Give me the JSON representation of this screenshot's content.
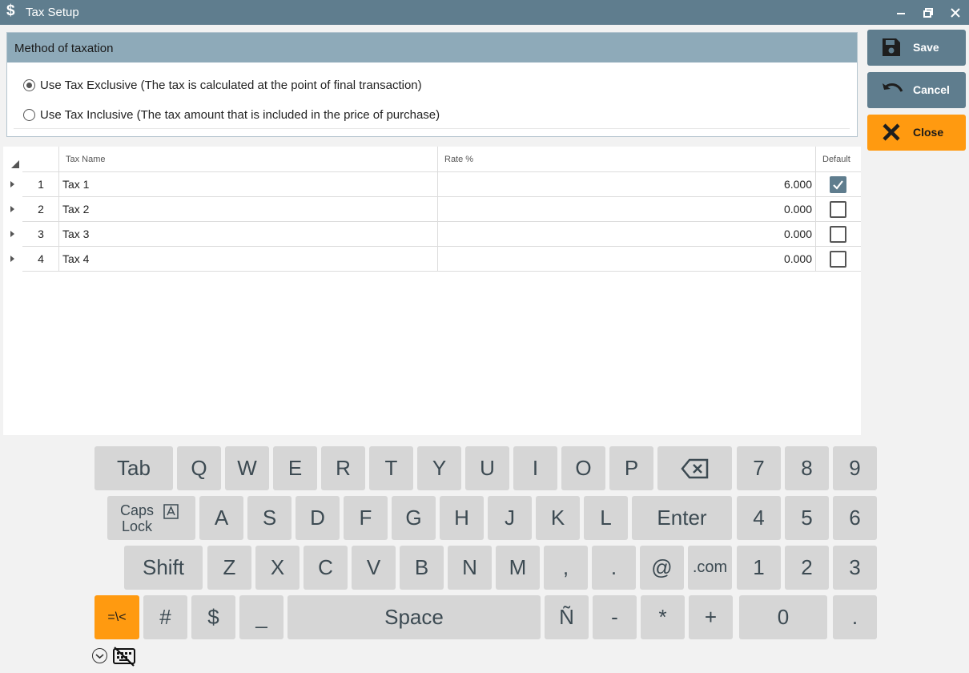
{
  "window": {
    "title": "Tax Setup",
    "icon": "dollar-icon",
    "icon_glyph": "$"
  },
  "taxation": {
    "header": "Method of taxation",
    "options": [
      {
        "label": "Use Tax Exclusive (The tax is calculated at the point of final transaction)",
        "selected": true
      },
      {
        "label": "Use Tax Inclusive (The tax amount that is included in the price of purchase)",
        "selected": false
      }
    ]
  },
  "grid": {
    "columns": {
      "name": "Tax Name",
      "rate": "Rate %",
      "default": "Default"
    },
    "rows": [
      {
        "num": "1",
        "name": "Tax 1",
        "rate": "6.000",
        "default": true
      },
      {
        "num": "2",
        "name": "Tax 2",
        "rate": "0.000",
        "default": false
      },
      {
        "num": "3",
        "name": "Tax 3",
        "rate": "0.000",
        "default": false
      },
      {
        "num": "4",
        "name": "Tax 4",
        "rate": "0.000",
        "default": false
      }
    ]
  },
  "actions": {
    "save": "Save",
    "cancel": "Cancel",
    "close": "Close"
  },
  "colors": {
    "titlebar": "#5f7d8e",
    "panel_header": "#8eaab9",
    "save_button": "#5f7d8e",
    "close_button": "#ff9a10",
    "key": "#d6d6d6",
    "key_accent": "#ff9a10"
  },
  "keyboard": {
    "row1": [
      "Tab",
      "Q",
      "W",
      "E",
      "R",
      "T",
      "Y",
      "U",
      "I",
      "O",
      "P",
      "⌫",
      "7",
      "8",
      "9"
    ],
    "row2": [
      "Caps Lock",
      "A",
      "S",
      "D",
      "F",
      "G",
      "H",
      "J",
      "K",
      "L",
      "Enter",
      "4",
      "5",
      "6"
    ],
    "row3": [
      "Shift",
      "Z",
      "X",
      "C",
      "V",
      "B",
      "N",
      "M",
      ",",
      ".",
      "@",
      ".com",
      "1",
      "2",
      "3"
    ],
    "row4": [
      "=\\<",
      "#",
      "$",
      "_",
      "Space",
      "Ñ",
      "-",
      "*",
      "+",
      "0",
      "."
    ]
  }
}
